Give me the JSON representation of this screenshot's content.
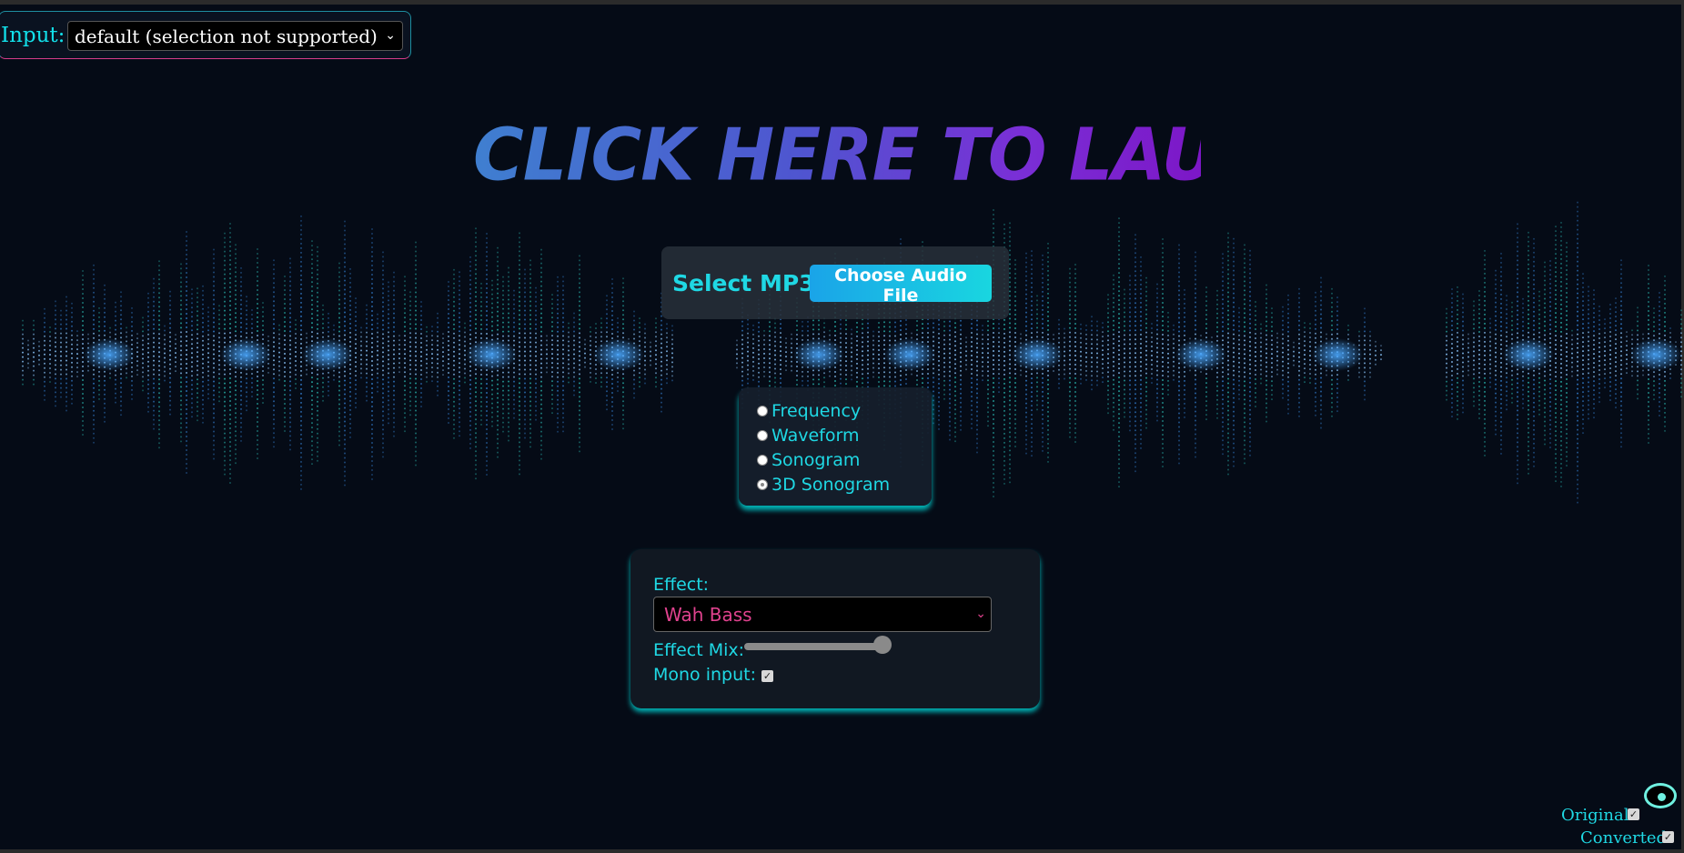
{
  "input": {
    "label": "Input:",
    "selected": "default (selection not supported)"
  },
  "launch": {
    "text": "CLICK HERE TO LAUNCH"
  },
  "mp3": {
    "label": "Select MP3",
    "button_label": "Choose Audio File"
  },
  "visualization_modes": {
    "options": [
      "Frequency",
      "Waveform",
      "Sonogram",
      "3D Sonogram"
    ],
    "selected": "3D Sonogram"
  },
  "effect": {
    "label": "Effect:",
    "selected": "Wah Bass",
    "mix_label": "Effect Mix:",
    "mix_value": 1.0,
    "mono_label": "Mono input:",
    "mono_checked": true
  },
  "output": {
    "original_label": "Original",
    "original_checked": true,
    "converted_label": "Converted",
    "converted_checked": true
  },
  "colors": {
    "accent": "#1fd8e4",
    "pink": "#e0428e",
    "background": "#050b16"
  }
}
